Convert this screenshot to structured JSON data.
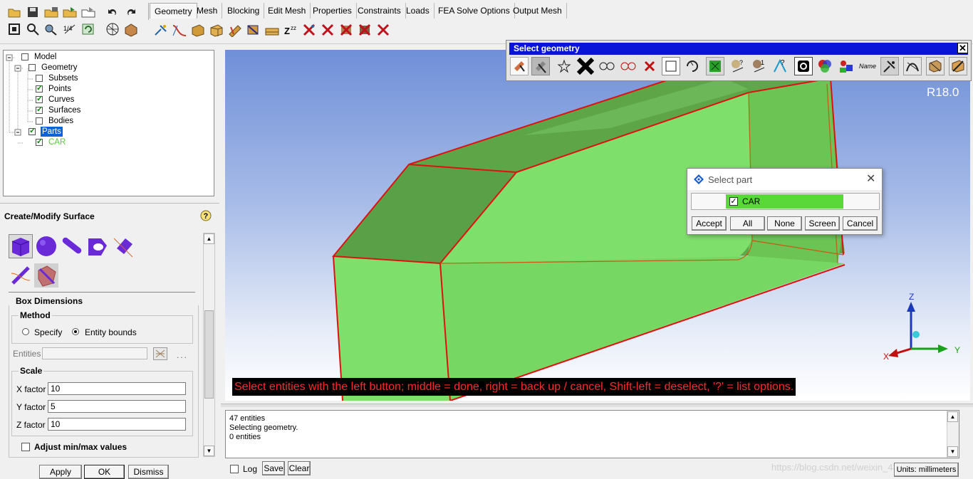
{
  "toolbar": {
    "tabs": [
      "Geometry",
      "Mesh",
      "Blocking",
      "Edit Mesh",
      "Properties",
      "Constraints",
      "Loads",
      "FEA Solve Options",
      "Output Mesh"
    ],
    "active_tab": "Geometry"
  },
  "tree": {
    "items": [
      "Model",
      "Geometry",
      "Subsets",
      "Points",
      "Curves",
      "Surfaces",
      "Bodies",
      "Parts",
      "CAR"
    ]
  },
  "panel": {
    "title": "Create/Modify Surface",
    "help_icon": "question-mark-icon",
    "box_dimensions": "Box Dimensions",
    "method_label": "Method",
    "method_options": [
      "Specify",
      "Entity bounds"
    ],
    "method_selected": "Entity bounds",
    "entities_label": "Entities",
    "entities_dots": "...",
    "scale_label": "Scale",
    "x_label": "X factor",
    "x_value": "10",
    "y_label": "Y factor",
    "y_value": "5",
    "z_label": "Z factor",
    "z_value": "10",
    "adjust_label": "Adjust min/max values",
    "apply": "Apply",
    "ok": "OK",
    "dismiss": "Dismiss"
  },
  "viewport": {
    "version": "R18.0",
    "prompt": "Select entities with the left button; middle = done, right = back up / cancel, Shift-left = deselect, '?' = list options.",
    "axes": {
      "z": "Z",
      "x": "X",
      "y": "Y"
    },
    "colors": {
      "bg_top": "#6f8fd8",
      "bg_bottom": "#ffffff",
      "body": "#7ee06a",
      "edge": "#e01010"
    }
  },
  "select_geometry": {
    "title": "Select geometry",
    "name_label": "Name"
  },
  "select_part": {
    "title": "Select part",
    "part": "CAR",
    "buttons": [
      "Accept",
      "All",
      "None",
      "Screen",
      "Cancel"
    ]
  },
  "message": {
    "lines": [
      "47 entities",
      "Selecting geometry.",
      "0 entities"
    ],
    "log_label": "Log",
    "save": "Save",
    "clear": "Clear",
    "units": "Units: millimeters",
    "watermark": "https://blog.csdn.net/weixin_43803302"
  }
}
